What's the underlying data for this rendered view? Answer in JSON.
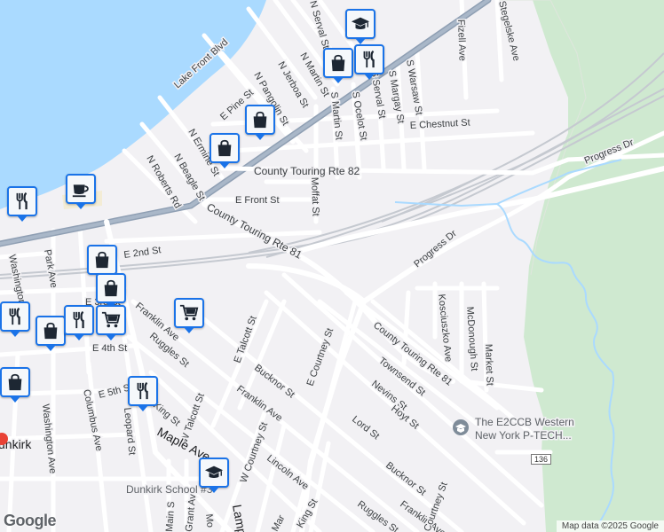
{
  "map": {
    "colors": {
      "water": "#aadaff",
      "land": "#f2f1f4",
      "park": "#cfe9d0",
      "road": "#ffffff",
      "highway": "#8f9fb3",
      "rail": "#c5c9d0",
      "pin_border": "#1a73e8",
      "label": "#3c4043"
    },
    "street_labels": {
      "serval_n": "N Serval St",
      "stegelske": "Stegelske Ave",
      "fizell": "Fizell Ave",
      "lake_front": "Lake Front Blvd",
      "pangolin": "N Pangolin St",
      "jerboa": "N Jerboa St",
      "martin_n": "N Martin St",
      "martin_s": "S Martin St",
      "ocelot": "S Ocelot St",
      "serval_s": "S Serval St",
      "margay": "S Margay St",
      "warsaw": "S Warsaw St",
      "e_pine": "E Pine St",
      "e_chestnut": "E Chestnut St",
      "progress_dr_1": "Progress Dr",
      "progress_dr_2": "Progress Dr",
      "ermine": "N Ermine St",
      "beagle": "N Beagle St",
      "roberts": "N Roberts Rd",
      "rte82": "County Touring Rte 82",
      "e_front": "E Front St",
      "moffat": "Moffat St",
      "rte81_a": "County Touring Rte 81",
      "rte81_b": "County Touring Rte 81",
      "e_2nd": "E 2nd St",
      "washington_n": "Washington Ave",
      "park_ave": "Park Ave",
      "e_3rd": "E 3rd St",
      "franklin_1": "Franklin Ave",
      "franklin_2": "Franklin Ave",
      "franklin_3": "Franklin Ave",
      "e_4th": "E 4th St",
      "ruggles_1": "Ruggles St",
      "ruggles_2": "Ruggles St",
      "e_talcott": "E Talcott St",
      "w_talcott": "W Talcott St",
      "bucknor_1": "Bucknor St",
      "bucknor_2": "Bucknor St",
      "e_courtney": "E Courtney St",
      "w_courtney": "W Courtney St",
      "townsend": "Townsend St",
      "nevins": "Nevins St",
      "hoyt": "Hoyt St",
      "lord": "Lord St",
      "kosciuszko": "Kosciuszko Ave",
      "mcdonough": "McDonough St",
      "market": "Market St",
      "e_5th": "E 5th St",
      "e_6th": "King St",
      "leopard": "Leopard St",
      "columbus": "Columbus Ave",
      "washington_s": "Washington Ave",
      "maple": "Maple Ave",
      "lincoln": "Lincoln Ave",
      "king_st": "King St",
      "grant": "Grant Av",
      "main_s": "Main S",
      "lamp": "Lamp",
      "mo": "Mo",
      "courtney_bottom": "Courtney St",
      "mar": "Mar"
    },
    "place_labels": {
      "school_name_line1": "The E2CCB Western",
      "school_name_line2": "New York P-TECH...",
      "dunkirk_school": "Dunkirk School #3",
      "city": "Dunkirk",
      "city_partial": "unkirk"
    },
    "route_shield": "136",
    "pins": [
      {
        "name": "school-pin",
        "icon": "graduation-cap-icon"
      },
      {
        "name": "shopping-pin",
        "icon": "shopping-bag-icon"
      },
      {
        "name": "restaurant-pin",
        "icon": "fork-knife-icon"
      },
      {
        "name": "shopping-pin",
        "icon": "shopping-bag-icon"
      },
      {
        "name": "shopping-pin",
        "icon": "shopping-bag-icon"
      },
      {
        "name": "restaurant-pin",
        "icon": "fork-knife-icon"
      },
      {
        "name": "cafe-pin",
        "icon": "coffee-cup-icon"
      },
      {
        "name": "shopping-pin",
        "icon": "shopping-bag-icon"
      },
      {
        "name": "shopping-pin",
        "icon": "shopping-bag-icon"
      },
      {
        "name": "grocery-pin",
        "icon": "shopping-cart-icon"
      },
      {
        "name": "restaurant-pin",
        "icon": "fork-knife-icon"
      },
      {
        "name": "shopping-pin",
        "icon": "shopping-bag-icon"
      },
      {
        "name": "restaurant-pin",
        "icon": "fork-knife-icon"
      },
      {
        "name": "grocery-pin",
        "icon": "shopping-cart-icon"
      },
      {
        "name": "shopping-pin",
        "icon": "shopping-bag-icon"
      },
      {
        "name": "restaurant-pin",
        "icon": "fork-knife-icon"
      },
      {
        "name": "school-pin",
        "icon": "graduation-cap-icon"
      }
    ],
    "attribution": "Map data ©2025 Google",
    "logo": "Google"
  }
}
